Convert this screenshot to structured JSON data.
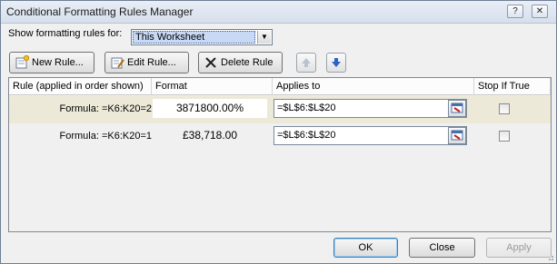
{
  "window": {
    "title": "Conditional Formatting Rules Manager",
    "help_glyph": "?",
    "close_glyph": "✕"
  },
  "show_rules": {
    "label": "Show formatting rules for:",
    "selected": "This Worksheet"
  },
  "toolbar": {
    "new_rule": "New Rule...",
    "edit_rule": "Edit Rule...",
    "delete_rule": "Delete Rule"
  },
  "table": {
    "headers": [
      "Rule (applied in order shown)",
      "Format",
      "Applies to",
      "Stop If True"
    ],
    "rows": [
      {
        "rule": "Formula: =K6:K20=2",
        "format": "3871800.00%",
        "applies_to": "=$L$6:$L$20",
        "stop_if_true": false,
        "selected": true
      },
      {
        "rule": "Formula: =K6:K20=1",
        "format": "£38,718.00",
        "applies_to": "=$L$6:$L$20",
        "stop_if_true": false,
        "selected": false
      }
    ]
  },
  "buttons": {
    "ok": "OK",
    "close": "Close",
    "apply": "Apply"
  },
  "colors": {
    "selected_row": "#ece9d8",
    "combo_highlight": "#c8d9f5",
    "arrow_blue": "#2b62c8"
  }
}
